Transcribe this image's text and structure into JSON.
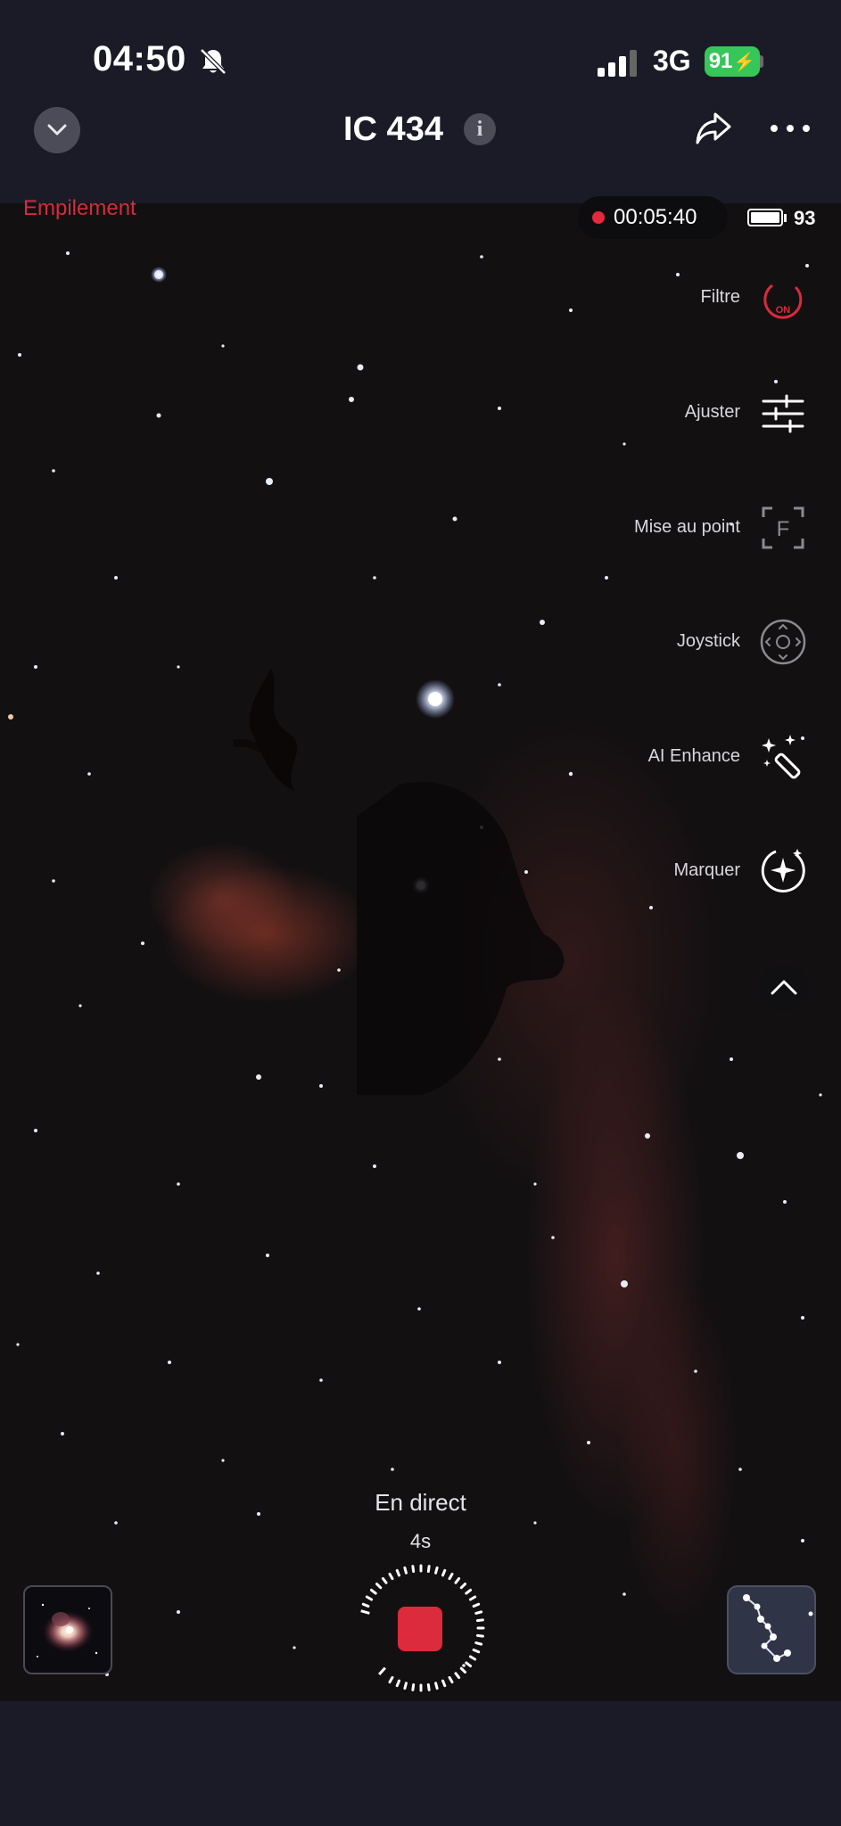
{
  "status_bar": {
    "time": "04:50",
    "network": "3G",
    "battery_percent": "91",
    "bell_icon": "bell-slash-icon",
    "signal_icon": "cellular-signal-icon"
  },
  "nav": {
    "title": "IC 434",
    "collapse_icon": "chevron-down-icon",
    "info_icon": "info-icon",
    "share_icon": "share-icon",
    "more_icon": "more-horizontal-icon"
  },
  "viewer": {
    "mode_label": "Empilement",
    "recording_time": "00:05:40",
    "device_battery": "93",
    "tools": [
      {
        "label": "Filtre",
        "icon": "filter-on-icon",
        "badge": "ON"
      },
      {
        "label": "Ajuster",
        "icon": "sliders-icon"
      },
      {
        "label": "Mise au point",
        "icon": "focus-frame-icon",
        "glyph": "F"
      },
      {
        "label": "Joystick",
        "icon": "joystick-icon"
      },
      {
        "label": "AI Enhance",
        "icon": "magic-wand-icon"
      },
      {
        "label": "Marquer",
        "icon": "sparkle-mark-icon"
      }
    ],
    "collapse_tools_icon": "chevron-up-icon"
  },
  "capture": {
    "mode": "En direct",
    "exposure": "4s",
    "stop_icon": "stop-record-icon",
    "gallery_icon": "gallery-thumbnail-icon",
    "skymap_icon": "constellation-icon"
  },
  "colors": {
    "background": "#1a1b26",
    "accent_red": "#dc2b3c",
    "battery_green": "#35c759"
  }
}
